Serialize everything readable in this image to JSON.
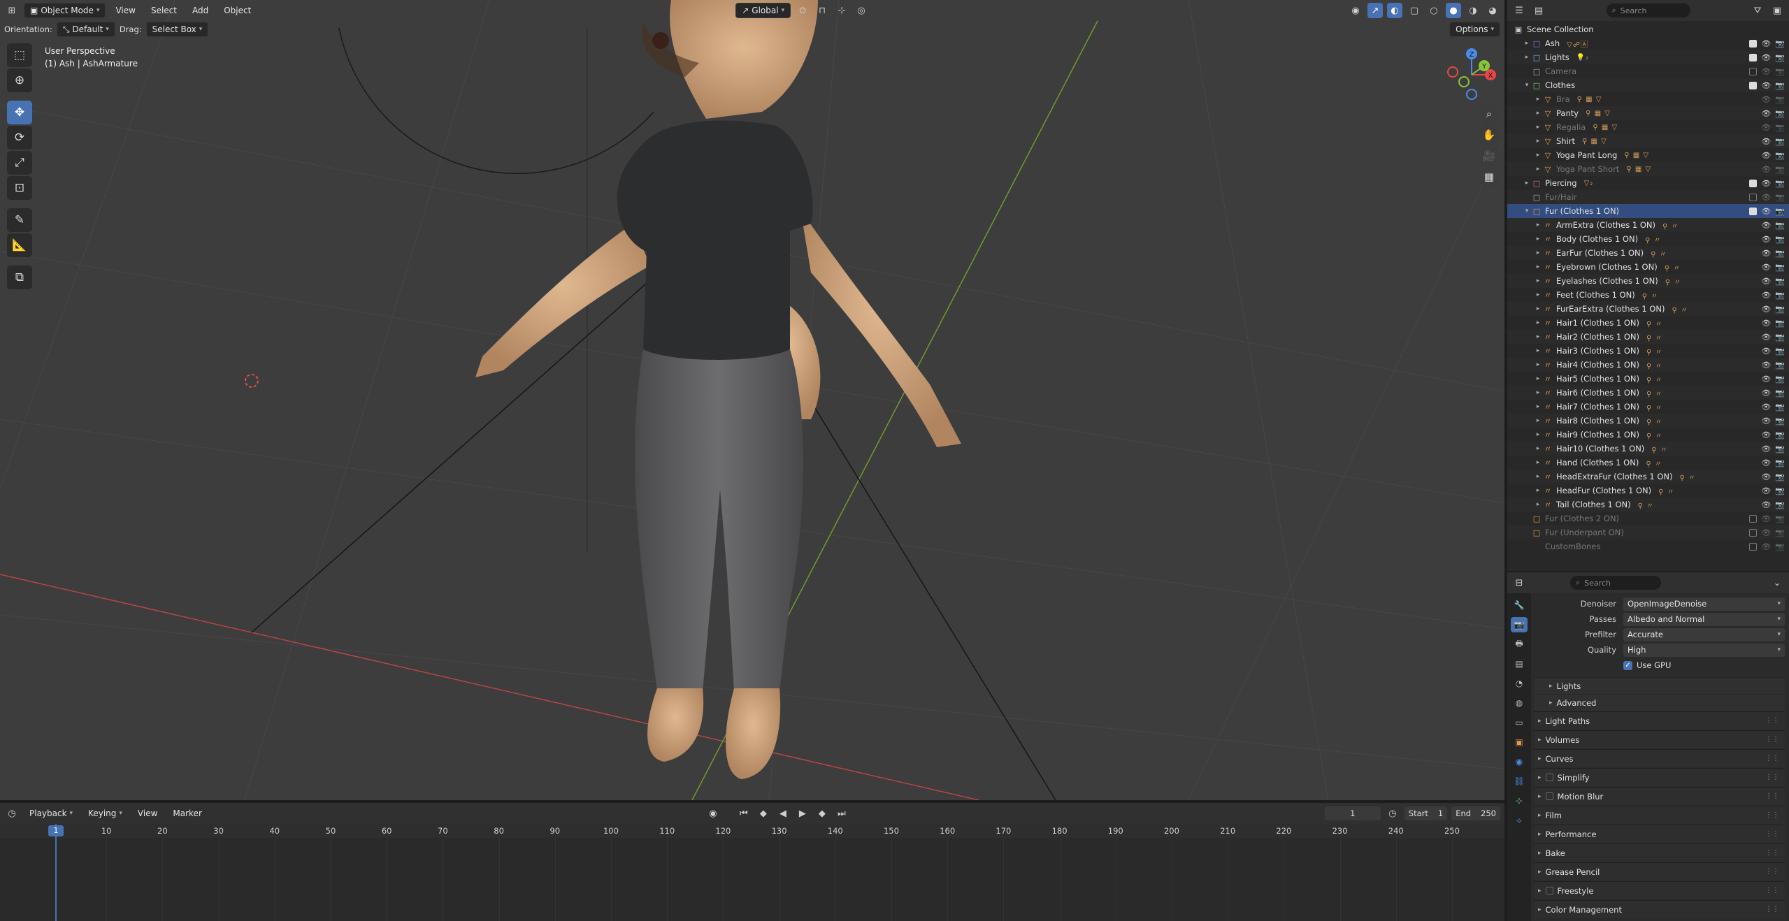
{
  "viewport": {
    "header": {
      "mode": "Object Mode",
      "menus": [
        "View",
        "Select",
        "Add",
        "Object"
      ],
      "transform_orientation": "Global",
      "options": "Options"
    },
    "subheader": {
      "orientation_label": "Orientation:",
      "orientation_value": "Default",
      "drag_label": "Drag:",
      "drag_value": "Select Box"
    },
    "info_line1": "User Perspective",
    "info_line2": "(1) Ash | AshArmature",
    "gizmo_axes": {
      "x": "X",
      "y": "Y",
      "z": "Z"
    },
    "colors": {
      "x_axis": "#e84545",
      "y_axis": "#89c53a",
      "z_axis": "#4a8ce8"
    }
  },
  "outliner": {
    "search_placeholder": "Search",
    "root": "Scene Collection",
    "rows": [
      {
        "label": "Ash",
        "level": 1,
        "expander": "▸",
        "icon": "□",
        "icon_color": "#9b6bd6",
        "dim": false,
        "sel": false,
        "check": true,
        "sub": "▽☍🄰"
      },
      {
        "label": "Lights",
        "level": 1,
        "expander": "▸",
        "icon": "□",
        "icon_color": "#6db3e8",
        "dim": false,
        "sel": false,
        "check": true,
        "sub": "💡₂"
      },
      {
        "label": "Camera",
        "level": 1,
        "expander": "",
        "icon": "□",
        "icon_color": "#b0b0b0",
        "dim": true,
        "sel": false,
        "check": false,
        "sub": ""
      },
      {
        "label": "Clothes",
        "level": 1,
        "expander": "▾",
        "icon": "□",
        "icon_color": "#6ecf7a",
        "dim": false,
        "sel": false,
        "check": true,
        "sub": ""
      },
      {
        "label": "Bra",
        "level": 2,
        "expander": "▸",
        "icon": "▽",
        "icon_color": "#e59a4b",
        "dim": true,
        "sel": false,
        "check": null,
        "sub": "⚲ ▦ ▽"
      },
      {
        "label": "Panty",
        "level": 2,
        "expander": "▸",
        "icon": "▽",
        "icon_color": "#e59a4b",
        "dim": false,
        "sel": false,
        "check": null,
        "sub": "⚲ ▦ ▽"
      },
      {
        "label": "Regalia",
        "level": 2,
        "expander": "▸",
        "icon": "▽",
        "icon_color": "#e59a4b",
        "dim": true,
        "sel": false,
        "check": null,
        "sub": "⚲ ▦ ▽"
      },
      {
        "label": "Shirt",
        "level": 2,
        "expander": "▸",
        "icon": "▽",
        "icon_color": "#e59a4b",
        "dim": false,
        "sel": false,
        "check": null,
        "sub": "⚲ ▦ ▽"
      },
      {
        "label": "Yoga Pant Long",
        "level": 2,
        "expander": "▸",
        "icon": "▽",
        "icon_color": "#e59a4b",
        "dim": false,
        "sel": false,
        "check": null,
        "sub": "⚲ ▦ ▽"
      },
      {
        "label": "Yoga Pant Short",
        "level": 2,
        "expander": "▸",
        "icon": "▽",
        "icon_color": "#e59a4b",
        "dim": true,
        "sel": false,
        "check": null,
        "sub": "⚲ ▦ ▽"
      },
      {
        "label": "Piercing",
        "level": 1,
        "expander": "▸",
        "icon": "□",
        "icon_color": "#d66bb8",
        "dim": false,
        "sel": false,
        "check": true,
        "sub": "▽₂"
      },
      {
        "label": "Fur/Hair",
        "level": 1,
        "expander": "",
        "icon": "□",
        "icon_color": "#b0b0b0",
        "dim": true,
        "sel": false,
        "check": false,
        "sub": ""
      },
      {
        "label": "Fur (Clothes 1 ON)",
        "level": 1,
        "expander": "▾",
        "icon": "□",
        "icon_color": "#e59a4b",
        "dim": false,
        "sel": true,
        "check": true,
        "sub": ""
      },
      {
        "label": "ArmExtra (Clothes 1 ON)",
        "level": 2,
        "expander": "▸",
        "icon": "〃",
        "icon_color": "#e59a4b",
        "dim": false,
        "sel": false,
        "check": null,
        "sub": "⚲ 〃"
      },
      {
        "label": "Body (Clothes 1 ON)",
        "level": 2,
        "expander": "▸",
        "icon": "〃",
        "icon_color": "#e59a4b",
        "dim": false,
        "sel": false,
        "check": null,
        "sub": "⚲ 〃"
      },
      {
        "label": "EarFur (Clothes 1 ON)",
        "level": 2,
        "expander": "▸",
        "icon": "〃",
        "icon_color": "#e59a4b",
        "dim": false,
        "sel": false,
        "check": null,
        "sub": "⚲ 〃"
      },
      {
        "label": "Eyebrown (Clothes 1 ON)",
        "level": 2,
        "expander": "▸",
        "icon": "〃",
        "icon_color": "#e59a4b",
        "dim": false,
        "sel": false,
        "check": null,
        "sub": "⚲ 〃"
      },
      {
        "label": "Eyelashes (Clothes 1 ON)",
        "level": 2,
        "expander": "▸",
        "icon": "〃",
        "icon_color": "#e59a4b",
        "dim": false,
        "sel": false,
        "check": null,
        "sub": "⚲ 〃"
      },
      {
        "label": "Feet (Clothes 1 ON)",
        "level": 2,
        "expander": "▸",
        "icon": "〃",
        "icon_color": "#e59a4b",
        "dim": false,
        "sel": false,
        "check": null,
        "sub": "⚲ 〃"
      },
      {
        "label": "FurEarExtra (Clothes 1 ON)",
        "level": 2,
        "expander": "▸",
        "icon": "〃",
        "icon_color": "#e59a4b",
        "dim": false,
        "sel": false,
        "check": null,
        "sub": "⚲ 〃"
      },
      {
        "label": "Hair1 (Clothes 1 ON)",
        "level": 2,
        "expander": "▸",
        "icon": "〃",
        "icon_color": "#e59a4b",
        "dim": false,
        "sel": false,
        "check": null,
        "sub": "⚲ 〃"
      },
      {
        "label": "Hair2 (Clothes 1 ON)",
        "level": 2,
        "expander": "▸",
        "icon": "〃",
        "icon_color": "#e59a4b",
        "dim": false,
        "sel": false,
        "check": null,
        "sub": "⚲ 〃"
      },
      {
        "label": "Hair3 (Clothes 1 ON)",
        "level": 2,
        "expander": "▸",
        "icon": "〃",
        "icon_color": "#e59a4b",
        "dim": false,
        "sel": false,
        "check": null,
        "sub": "⚲ 〃"
      },
      {
        "label": "Hair4 (Clothes 1 ON)",
        "level": 2,
        "expander": "▸",
        "icon": "〃",
        "icon_color": "#e59a4b",
        "dim": false,
        "sel": false,
        "check": null,
        "sub": "⚲ 〃"
      },
      {
        "label": "Hair5 (Clothes 1 ON)",
        "level": 2,
        "expander": "▸",
        "icon": "〃",
        "icon_color": "#e59a4b",
        "dim": false,
        "sel": false,
        "check": null,
        "sub": "⚲ 〃"
      },
      {
        "label": "Hair6 (Clothes 1 ON)",
        "level": 2,
        "expander": "▸",
        "icon": "〃",
        "icon_color": "#e59a4b",
        "dim": false,
        "sel": false,
        "check": null,
        "sub": "⚲ 〃"
      },
      {
        "label": "Hair7 (Clothes 1 ON)",
        "level": 2,
        "expander": "▸",
        "icon": "〃",
        "icon_color": "#e59a4b",
        "dim": false,
        "sel": false,
        "check": null,
        "sub": "⚲ 〃"
      },
      {
        "label": "Hair8 (Clothes 1 ON)",
        "level": 2,
        "expander": "▸",
        "icon": "〃",
        "icon_color": "#e59a4b",
        "dim": false,
        "sel": false,
        "check": null,
        "sub": "⚲ 〃"
      },
      {
        "label": "Hair9 (Clothes 1 ON)",
        "level": 2,
        "expander": "▸",
        "icon": "〃",
        "icon_color": "#e59a4b",
        "dim": false,
        "sel": false,
        "check": null,
        "sub": "⚲ 〃"
      },
      {
        "label": "Hair10 (Clothes 1 ON)",
        "level": 2,
        "expander": "▸",
        "icon": "〃",
        "icon_color": "#e59a4b",
        "dim": false,
        "sel": false,
        "check": null,
        "sub": "⚲ 〃"
      },
      {
        "label": "Hand (Clothes 1 ON)",
        "level": 2,
        "expander": "▸",
        "icon": "〃",
        "icon_color": "#e59a4b",
        "dim": false,
        "sel": false,
        "check": null,
        "sub": "⚲ 〃"
      },
      {
        "label": "HeadExtraFur (Clothes 1 ON)",
        "level": 2,
        "expander": "▸",
        "icon": "〃",
        "icon_color": "#e59a4b",
        "dim": false,
        "sel": false,
        "check": null,
        "sub": "⚲ 〃"
      },
      {
        "label": "HeadFur (Clothes 1 ON)",
        "level": 2,
        "expander": "▸",
        "icon": "〃",
        "icon_color": "#e59a4b",
        "dim": false,
        "sel": false,
        "check": null,
        "sub": "⚲ 〃"
      },
      {
        "label": "Tail (Clothes 1 ON)",
        "level": 2,
        "expander": "▸",
        "icon": "〃",
        "icon_color": "#e59a4b",
        "dim": false,
        "sel": false,
        "check": null,
        "sub": "⚲ 〃"
      },
      {
        "label": "Fur (Clothes 2 ON)",
        "level": 1,
        "expander": "",
        "icon": "□",
        "icon_color": "#e59a4b",
        "dim": true,
        "sel": false,
        "check": false,
        "sub": ""
      },
      {
        "label": "Fur (Underpant ON)",
        "level": 1,
        "expander": "",
        "icon": "□",
        "icon_color": "#e59a4b",
        "dim": true,
        "sel": false,
        "check": false,
        "sub": ""
      },
      {
        "label": "CustomBones",
        "level": 1,
        "expander": "",
        "icon": "",
        "icon_color": "#b0b0b0",
        "dim": true,
        "sel": false,
        "check": false,
        "sub": ""
      }
    ]
  },
  "properties": {
    "search_placeholder": "Search",
    "fields": [
      {
        "label": "Denoiser",
        "value": "OpenImageDenoise"
      },
      {
        "label": "Passes",
        "value": "Albedo and Normal"
      },
      {
        "label": "Prefilter",
        "value": "Accurate"
      },
      {
        "label": "Quality",
        "value": "High"
      }
    ],
    "use_gpu": "Use GPU",
    "subsections": [
      "Lights",
      "Advanced"
    ],
    "sections": [
      {
        "label": "Light Paths",
        "checkbox": false
      },
      {
        "label": "Volumes",
        "checkbox": false
      },
      {
        "label": "Curves",
        "checkbox": false
      },
      {
        "label": "Simplify",
        "checkbox": true
      },
      {
        "label": "Motion Blur",
        "checkbox": true
      },
      {
        "label": "Film",
        "checkbox": false
      },
      {
        "label": "Performance",
        "checkbox": false
      },
      {
        "label": "Bake",
        "checkbox": false
      },
      {
        "label": "Grease Pencil",
        "checkbox": false
      },
      {
        "label": "Freestyle",
        "checkbox": true
      },
      {
        "label": "Color Management",
        "checkbox": false
      }
    ]
  },
  "timeline": {
    "menus": [
      "Playback",
      "Keying",
      "View",
      "Marker"
    ],
    "current_frame": "1",
    "start_label": "Start",
    "start_value": "1",
    "end_label": "End",
    "end_value": "250",
    "ruler": [
      "10",
      "20",
      "30",
      "40",
      "50",
      "60",
      "70",
      "80",
      "90",
      "100",
      "110",
      "120",
      "130",
      "140",
      "150",
      "160",
      "170",
      "180",
      "190",
      "200",
      "210",
      "220",
      "230",
      "240",
      "250"
    ],
    "playhead_label": "1",
    "colors": {
      "playhead": "#4772b3"
    }
  }
}
